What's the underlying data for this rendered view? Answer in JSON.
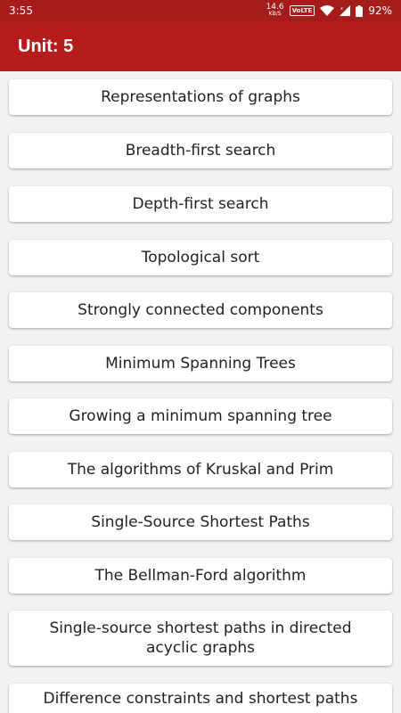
{
  "status_bar": {
    "time": "3:55",
    "net_speed_value": "14.6",
    "net_speed_unit": "KB/S",
    "volte_label": "VoLTE",
    "battery_percent": "92%",
    "icons": [
      "wifi-icon",
      "signal-icon",
      "battery-icon"
    ]
  },
  "app_bar": {
    "title": "Unit: 5"
  },
  "topics": [
    {
      "label": "Representations of graphs"
    },
    {
      "label": "Breadth-first search"
    },
    {
      "label": "Depth-first search"
    },
    {
      "label": "Topological sort"
    },
    {
      "label": "Strongly connected components"
    },
    {
      "label": "Minimum Spanning Trees"
    },
    {
      "label": "Growing a minimum spanning tree"
    },
    {
      "label": "The algorithms of Kruskal and Prim"
    },
    {
      "label": "Single-Source Shortest Paths"
    },
    {
      "label": "The Bellman-Ford algorithm"
    },
    {
      "label": "Single-source shortest paths in directed acyclic graphs"
    },
    {
      "label": "Difference constraints and shortest paths"
    }
  ],
  "colors": {
    "app_bar": "#b71c1c",
    "status_bar": "#a41d1b",
    "background": "#f2f2f2",
    "card": "#ffffff",
    "text": "#222222"
  }
}
